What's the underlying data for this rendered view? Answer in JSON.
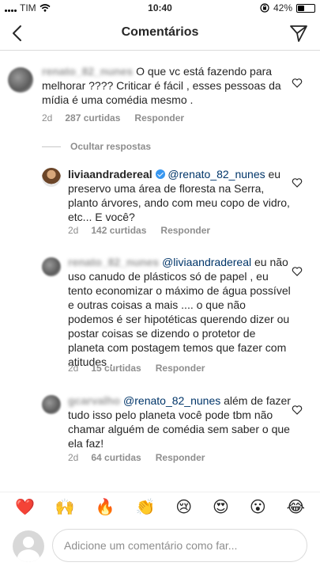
{
  "status_bar": {
    "carrier": "TIM",
    "time": "10:40",
    "battery_pct": "42%",
    "battery_level": 0.42
  },
  "header": {
    "title": "Comentários"
  },
  "comments": [
    {
      "username": "renato_82_nunes",
      "text": "O que vc está fazendo para melhorar ???? Criticar é fácil , esses pessoas da mídia é uma comédia mesmo .",
      "time": "2d",
      "likes": "287 curtidas",
      "reply": "Responder"
    },
    {
      "username": "liviaandradereal",
      "mention": "@renato_82_nunes",
      "text": "eu preservo uma área de floresta na Serra, planto árvores, ando com meu copo de vidro, etc... E você?",
      "time": "2d",
      "likes": "142 curtidas",
      "reply": "Responder"
    },
    {
      "username": "renato_82_nunes",
      "mention": "@liviaandradereal",
      "text": "eu não uso canudo de plásticos só de papel , eu tento economizar o máximo de água possível e outras coisas a mais .... o que não podemos é ser hipotéticas querendo dizer ou postar coisas se dizendo o protetor de planeta com postagem temos que fazer com atitudes .",
      "time": "2d",
      "likes": "15 curtidas",
      "reply": "Responder"
    },
    {
      "username": "gcarvalho",
      "mention": "@renato_82_nunes",
      "text": "além de fazer tudo isso pelo planeta você pode tbm não chamar alguém de comédia sem saber o que ela faz!",
      "time": "2d",
      "likes": "64 curtidas",
      "reply": "Responder"
    }
  ],
  "hide_replies": "Ocultar respostas",
  "emojis": [
    "❤️",
    "🙌",
    "🔥",
    "👏",
    "😢",
    "😍",
    "😮",
    "😂"
  ],
  "composer": {
    "placeholder": "Adicione um comentário como far..."
  }
}
